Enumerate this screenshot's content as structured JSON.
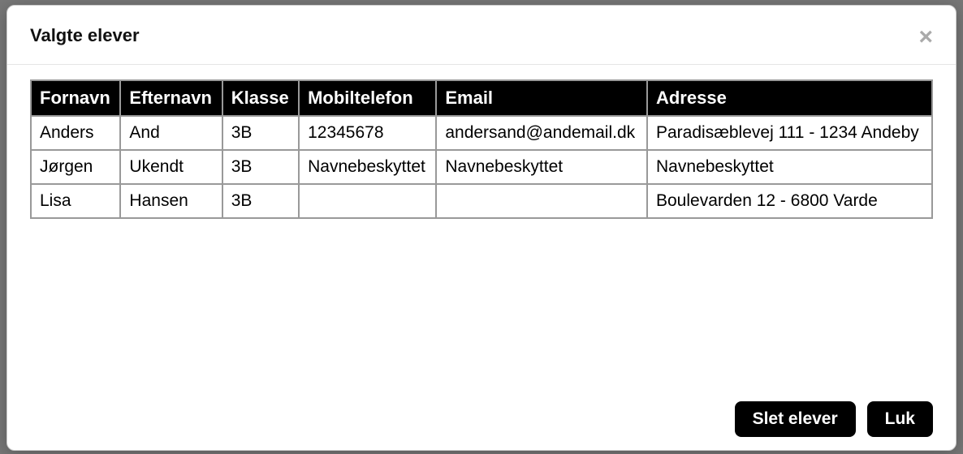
{
  "modal": {
    "title": "Valgte elever"
  },
  "table": {
    "headers": {
      "fornavn": "Fornavn",
      "efternavn": "Efternavn",
      "klasse": "Klasse",
      "mobil": "Mobiltelefon",
      "email": "Email",
      "adresse": "Adresse"
    },
    "rows": [
      {
        "fornavn": "Anders",
        "efternavn": "And",
        "klasse": "3B",
        "mobil": "12345678",
        "email": "andersand@andemail.dk",
        "adresse": "Paradisæblevej 111 - 1234 Andeby"
      },
      {
        "fornavn": "Jørgen",
        "efternavn": "Ukendt",
        "klasse": "3B",
        "mobil": "Navnebeskyttet",
        "email": "Navnebeskyttet",
        "adresse": "Navnebeskyttet"
      },
      {
        "fornavn": "Lisa",
        "efternavn": "Hansen",
        "klasse": "3B",
        "mobil": "",
        "email": "",
        "adresse": "Boulevarden 12 - 6800 Varde"
      }
    ]
  },
  "footer": {
    "delete_label": "Slet elever",
    "close_label": "Luk"
  }
}
